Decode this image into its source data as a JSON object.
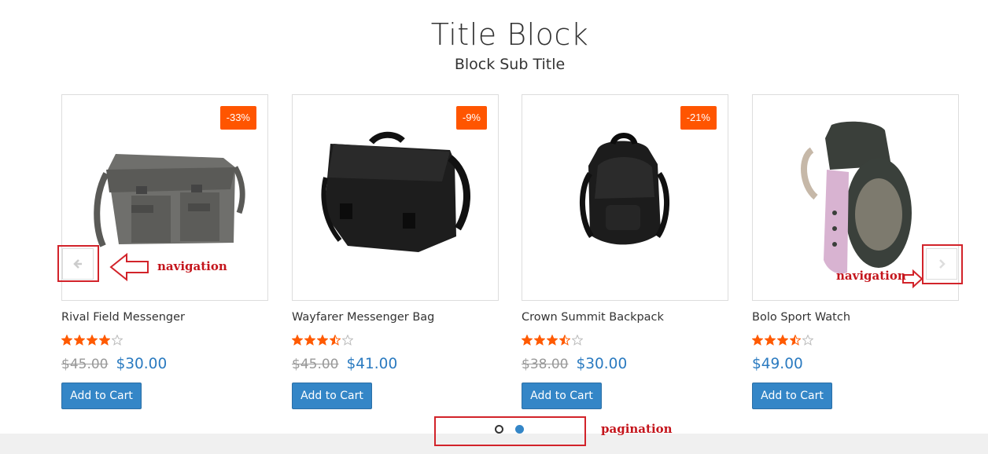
{
  "header": {
    "title": "Title Block",
    "subtitle": "Block Sub Title"
  },
  "products": [
    {
      "name": "Rival Field Messenger",
      "discount": "-33%",
      "old_price": "$45.00",
      "price": "$30.00",
      "rating": 4,
      "image_icon": "messenger-bag-gray"
    },
    {
      "name": "Wayfarer Messenger Bag",
      "discount": "-9%",
      "old_price": "$45.00",
      "price": "$41.00",
      "rating": 3.5,
      "image_icon": "messenger-bag-black"
    },
    {
      "name": "Crown Summit Backpack",
      "discount": "-21%",
      "old_price": "$38.00",
      "price": "$30.00",
      "rating": 3.5,
      "image_icon": "backpack-black"
    },
    {
      "name": "Bolo Sport Watch",
      "discount": "",
      "old_price": "",
      "price": "$49.00",
      "rating": 3.5,
      "image_icon": "sport-watch"
    }
  ],
  "buttons": {
    "add_to_cart": "Add to Cart"
  },
  "annotations": {
    "left_nav": "navigation",
    "right_nav": "navigation",
    "pagination": "pagination"
  },
  "pagination": {
    "pages": 2,
    "active": 2
  },
  "colors": {
    "badge": "#ff5500",
    "price": "#2a7ac0",
    "button": "#3486c7",
    "star": "#ff5a00",
    "annotation": "#d2232a"
  }
}
